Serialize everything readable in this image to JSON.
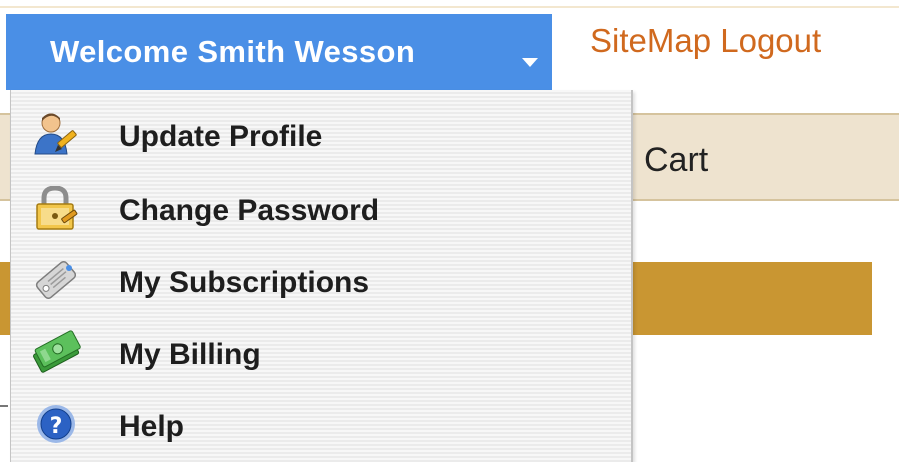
{
  "header": {
    "welcome_label": "Welcome Smith Wesson",
    "links": [
      "SiteMap",
      "Logout"
    ]
  },
  "nav": {
    "cart_label": "Cart"
  },
  "menu": {
    "items": [
      {
        "label": "Update Profile",
        "icon": "user-edit-icon"
      },
      {
        "label": "Change Password",
        "icon": "lock-icon"
      },
      {
        "label": "My Subscriptions",
        "icon": "tag-icon"
      },
      {
        "label": "My Billing",
        "icon": "money-icon"
      },
      {
        "label": "Help",
        "icon": "help-icon"
      }
    ]
  },
  "colors": {
    "accent_blue": "#4a8fe6",
    "link_orange": "#d0691e",
    "gold_bar": "#c99632",
    "nav_bg": "#eee3cf"
  }
}
